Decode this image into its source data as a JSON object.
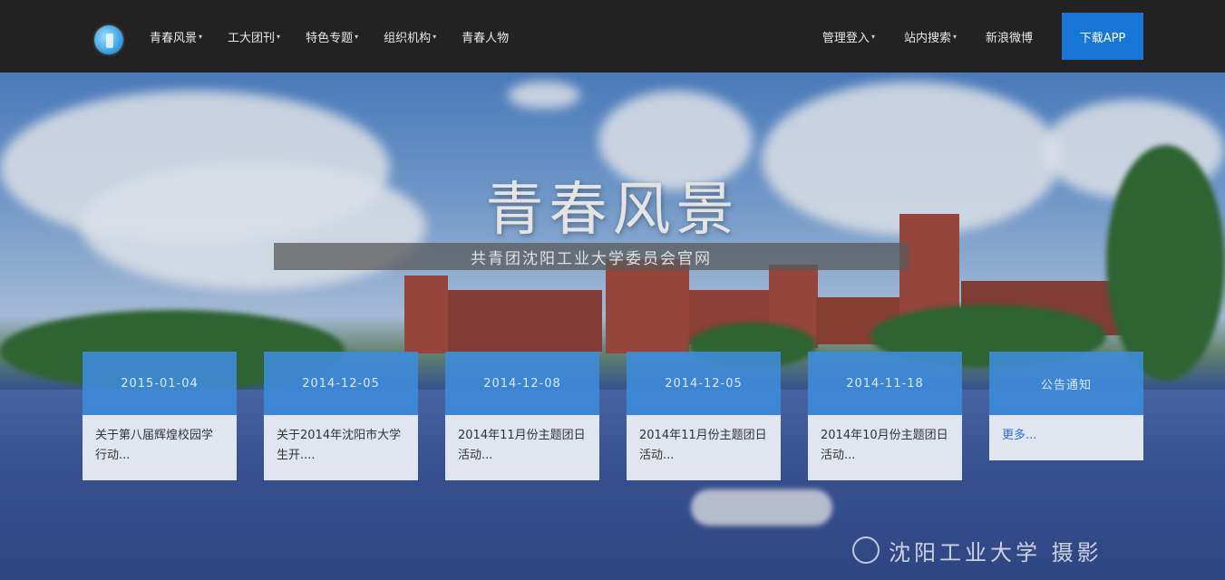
{
  "nav": {
    "left_items": [
      {
        "label": "青春风景",
        "caret": "▾"
      },
      {
        "label": "工大团刊",
        "caret": "▾"
      },
      {
        "label": "特色专题",
        "caret": "▾"
      },
      {
        "label": "组织机构",
        "caret": "▾"
      },
      {
        "label": "青春人物",
        "caret": ""
      }
    ],
    "right_items": [
      {
        "label": "管理登入",
        "caret": "▾"
      },
      {
        "label": "站内搜索",
        "caret": "▾"
      },
      {
        "label": "新浪微博",
        "caret": ""
      }
    ],
    "download_label": "下载APP"
  },
  "hero": {
    "title": "青春风景",
    "subtitle": "共青团沈阳工业大学委员会官网",
    "watermark": "沈阳工业大学 摄影"
  },
  "cards": [
    {
      "date": "2015-01-04",
      "text": "关于第八届辉煌校园学行动..."
    },
    {
      "date": "2014-12-05",
      "text": "关于2014年沈阳市大学生开...."
    },
    {
      "date": "2014-12-08",
      "text": "2014年11月份主题团日活动..."
    },
    {
      "date": "2014-12-05",
      "text": "2014年11月份主题团日活动..."
    },
    {
      "date": "2014-11-18",
      "text": "2014年10月份主题团日活动..."
    }
  ],
  "notice": {
    "title": "公告通知",
    "more": "更多..."
  },
  "colors": {
    "accent": "#1877d6",
    "navbar": "#222222",
    "card_header": "#3e8cdc"
  }
}
